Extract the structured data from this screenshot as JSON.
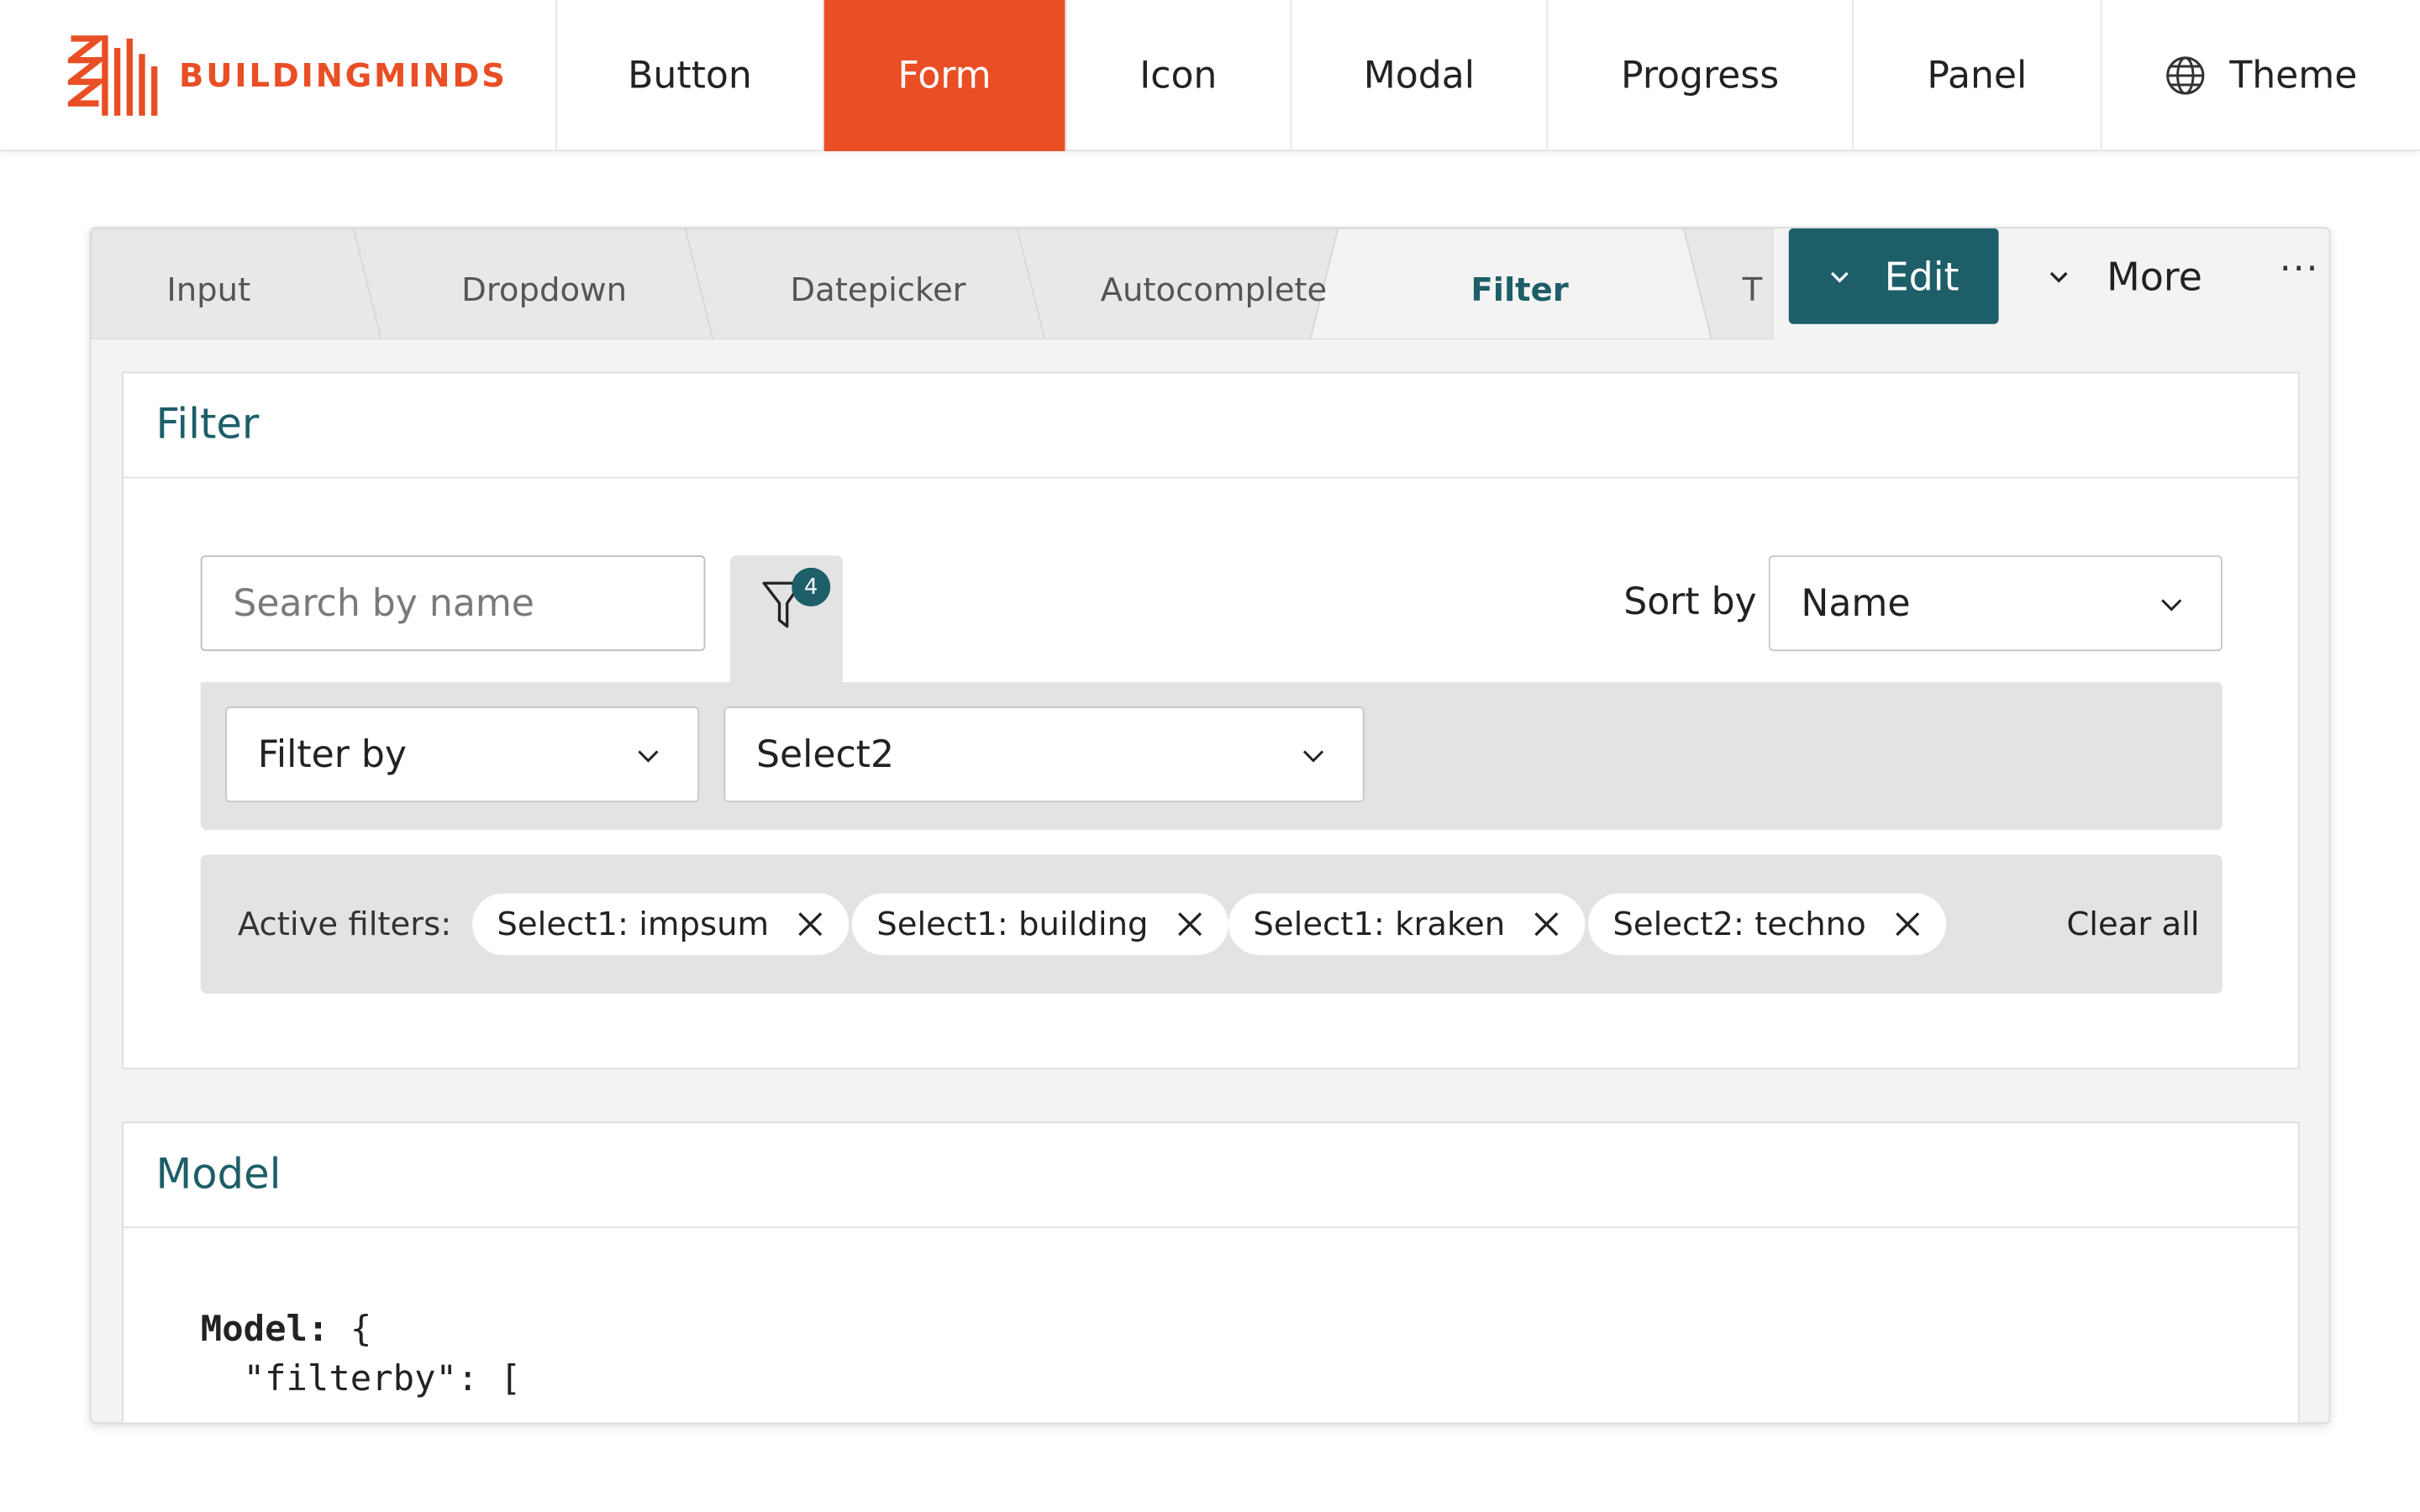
{
  "brand": {
    "name": "BUILDINGMINDS",
    "color": "#e94e24"
  },
  "topnav": {
    "items": [
      {
        "label": "Button"
      },
      {
        "label": "Form"
      },
      {
        "label": "Icon"
      },
      {
        "label": "Modal"
      },
      {
        "label": "Progress"
      },
      {
        "label": "Panel"
      }
    ],
    "active": "Form",
    "theme": {
      "label": "Theme",
      "icon": "globe-icon"
    }
  },
  "tabs": {
    "items": [
      {
        "label": "Input"
      },
      {
        "label": "Dropdown"
      },
      {
        "label": "Datepicker"
      },
      {
        "label": "Autocomplete"
      },
      {
        "label": "Filter"
      },
      {
        "label": "T"
      }
    ],
    "active": "Filter"
  },
  "actions": {
    "edit_label": "Edit",
    "more_label": "More",
    "overflow_label": "···"
  },
  "filter_panel": {
    "title": "Filter",
    "search": {
      "placeholder": "Search by name",
      "value": ""
    },
    "filter_badge_count": "4",
    "sort": {
      "label": "Sort by",
      "value": "Name"
    },
    "filter_by": {
      "value": "Filter by"
    },
    "select2": {
      "value": "Select2"
    },
    "active_filters": {
      "label": "Active filters:",
      "chips": [
        {
          "label": "Select1: impsum"
        },
        {
          "label": "Select1: building"
        },
        {
          "label": "Select1: kraken"
        },
        {
          "label": "Select2: techno"
        }
      ],
      "clear_label": "Clear all"
    }
  },
  "model_panel": {
    "title": "Model",
    "code_line1_key": "Model:",
    "code_line1_rest": " {",
    "code_line2": "  \"filterby\": ["
  },
  "colors": {
    "accent": "#e94e24",
    "primary": "#1d5e68",
    "surface": "#f3f3f3",
    "well": "#e3e3e3"
  }
}
